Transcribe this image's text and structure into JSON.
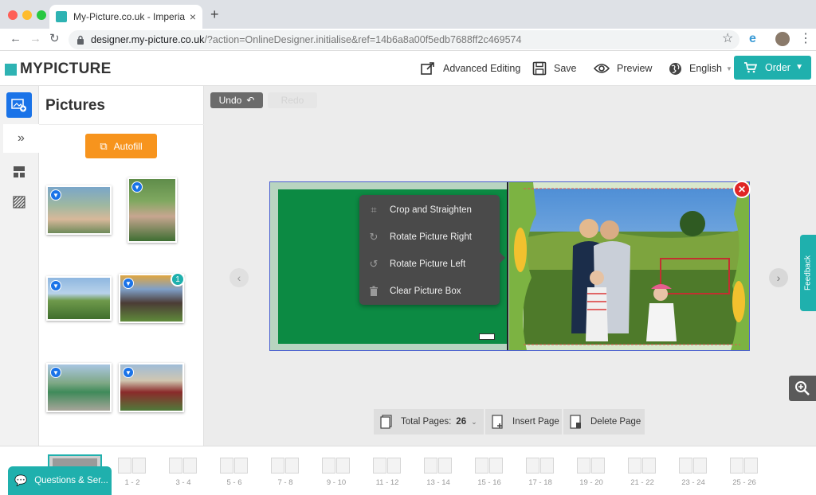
{
  "browser": {
    "tab_title": "My-Picture.co.uk - Imperial Ph",
    "tab_close": "×",
    "new_tab": "+",
    "url_main": "designer.my-picture.co.uk",
    "url_rest": "/?action=OnlineDesigner.initialise&ref=14b6a8a00f5edb7688ff2c469574"
  },
  "header": {
    "logo": "MYPICTURE",
    "advanced_editing": "Advanced Editing",
    "save": "Save",
    "preview": "Preview",
    "language": "English",
    "order": "Order"
  },
  "panel": {
    "title": "Pictures",
    "autofill": "Autofill",
    "thumb_used_count": "1"
  },
  "canvas": {
    "undo": "Undo",
    "redo": "Redo",
    "context_menu": [
      {
        "label": "Crop and Straighten"
      },
      {
        "label": "Rotate Picture Right"
      },
      {
        "label": "Rotate Picture Left"
      },
      {
        "label": "Clear Picture Box"
      }
    ],
    "feedback": "Feedback",
    "total_pages_label": "Total Pages:",
    "total_pages_value": "26",
    "insert_page": "Insert Page",
    "delete_page": "Delete Page"
  },
  "filmstrip": {
    "pages": [
      "1 - 2",
      "3 - 4",
      "5 - 6",
      "7 - 8",
      "9 - 10",
      "11 - 12",
      "13 - 14",
      "15 - 16",
      "17 - 18",
      "19 - 20",
      "21 - 22",
      "23 - 24",
      "25 - 26"
    ]
  },
  "chat": {
    "label": "Questions & Ser..."
  },
  "colors": {
    "accent": "#1fb0ad",
    "autofill": "#f7941d",
    "close": "#e02525",
    "selection_border": "#4a5fd0"
  }
}
